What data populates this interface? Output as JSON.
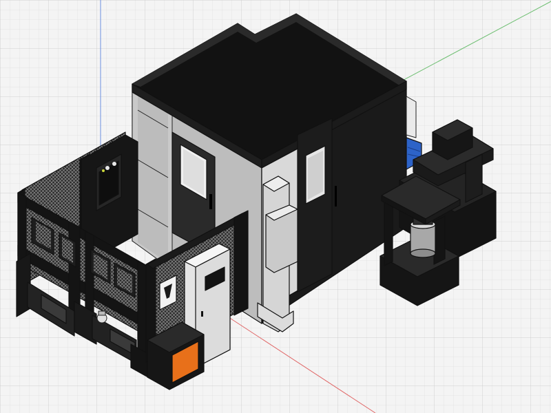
{
  "colors": {
    "background": "#f4f4f4",
    "grid_minor": "#e3e3e3",
    "grid_major": "#cfcfcf",
    "axis_x": "#e06666",
    "axis_y": "#6fbf73",
    "axis_z": "#6d8fe0",
    "body_black": "#141414",
    "body_dark": "#232323",
    "panel_gray": "#b9b9b9",
    "panel_light": "#dedede",
    "cabinet_white": "#eeeeee",
    "accent_orange": "#e8701a",
    "accent_blue": "#2d63c8"
  },
  "view": {
    "axes": [
      "x-axis",
      "y-axis",
      "z-axis"
    ],
    "model": "machine-enclosure-assembly"
  }
}
